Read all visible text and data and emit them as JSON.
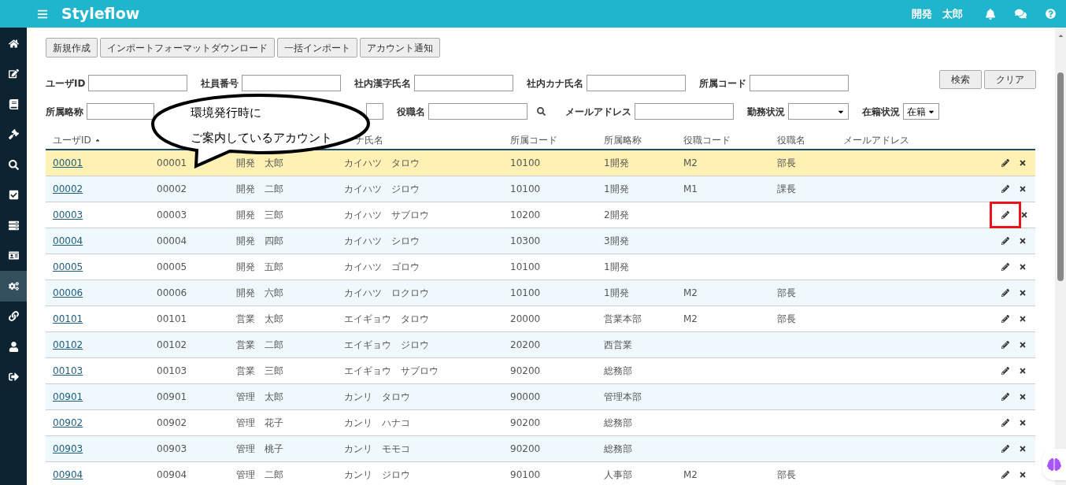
{
  "app": {
    "title": "Styleflow",
    "user_name": "開発　太郎"
  },
  "sidebar": {
    "items": [
      {
        "kind": "home",
        "selected": false
      },
      {
        "kind": "edit",
        "selected": false
      },
      {
        "kind": "book",
        "selected": false
      },
      {
        "kind": "gavel",
        "selected": false
      },
      {
        "kind": "search",
        "selected": false
      },
      {
        "kind": "check",
        "selected": false
      },
      {
        "kind": "list",
        "selected": false
      },
      {
        "kind": "card",
        "selected": false
      },
      {
        "kind": "cogs",
        "selected": true
      },
      {
        "kind": "link",
        "selected": false
      },
      {
        "kind": "user",
        "selected": false
      },
      {
        "kind": "logout",
        "selected": false
      }
    ]
  },
  "toolbar": {
    "buttons": [
      "新規作成",
      "インポートフォーマットダウンロード",
      "一括インポート",
      "アカウント通知"
    ]
  },
  "filters": {
    "row_1": [
      {
        "kind": "input",
        "label": "ユーザID"
      },
      {
        "kind": "input",
        "label": "社員番号"
      },
      {
        "kind": "input",
        "label": "社内漢字氏名"
      },
      {
        "kind": "input",
        "label": "社内カナ氏名"
      },
      {
        "kind": "input",
        "label": "所属コード"
      }
    ],
    "row_2": [
      {
        "kind": "input",
        "label": "所属略称"
      },
      {
        "kind": "input"
      },
      {
        "kind": "search_input",
        "label": "役職名"
      },
      {
        "kind": "input",
        "label": "メールアドレス"
      },
      {
        "kind": "select",
        "label": "勤務状況"
      },
      {
        "kind": "select",
        "label": "在籍状況",
        "value": "在籍"
      }
    ],
    "buttons": [
      "検索",
      "クリア"
    ]
  },
  "callout": {
    "lines": [
      "環境発行時に",
      "ご案内しているアカウント"
    ]
  },
  "table": {
    "columns": [
      {
        "label": "ユーザID",
        "sorted": true
      },
      {},
      {},
      {
        "label": "ナ氏名"
      },
      {
        "label": "所属コード"
      },
      {
        "label": "所属略称"
      },
      {
        "label": "役職コード"
      },
      {
        "label": "役職名"
      },
      {
        "label": "メールアドレス"
      }
    ],
    "rows": [
      {
        "user_id": "00001",
        "employee_no": "00001",
        "name": "開発　太郎",
        "kana": "カイハツ　タロウ",
        "dept_code": "10100",
        "dept_abbr": "1開発",
        "title_code": "M2",
        "title": "部長",
        "selected": true,
        "edit_marked": false
      },
      {
        "user_id": "00002",
        "employee_no": "00002",
        "name": "開発　二郎",
        "kana": "カイハツ　ジロウ",
        "dept_code": "10100",
        "dept_abbr": "1開発",
        "title_code": "M1",
        "title": "課長",
        "selected": false,
        "edit_marked": false
      },
      {
        "user_id": "00003",
        "employee_no": "00003",
        "name": "開発　三郎",
        "kana": "カイハツ　サブロウ",
        "dept_code": "10200",
        "dept_abbr": "2開発",
        "selected": false,
        "edit_marked": true
      },
      {
        "user_id": "00004",
        "employee_no": "00004",
        "name": "開発　四郎",
        "kana": "カイハツ　シロウ",
        "dept_code": "10300",
        "dept_abbr": "3開発",
        "selected": false,
        "edit_marked": false
      },
      {
        "user_id": "00005",
        "employee_no": "00005",
        "name": "開発　五郎",
        "kana": "カイハツ　ゴロウ",
        "dept_code": "10100",
        "dept_abbr": "1開発",
        "selected": false,
        "edit_marked": false
      },
      {
        "user_id": "00006",
        "employee_no": "00006",
        "name": "開発　六郎",
        "kana": "カイハツ　ロクロウ",
        "dept_code": "10100",
        "dept_abbr": "1開発",
        "title_code": "M2",
        "title": "部長",
        "selected": false,
        "edit_marked": false
      },
      {
        "user_id": "00101",
        "employee_no": "00101",
        "name": "営業　太郎",
        "kana": "エイギョウ　タロウ",
        "dept_code": "20000",
        "dept_abbr": "営業本部",
        "title_code": "M2",
        "title": "部長",
        "selected": false,
        "edit_marked": false
      },
      {
        "user_id": "00102",
        "employee_no": "00102",
        "name": "営業　二郎",
        "kana": "エイギョウ　ジロウ",
        "dept_code": "20200",
        "dept_abbr": "西営業",
        "selected": false,
        "edit_marked": false
      },
      {
        "user_id": "00103",
        "employee_no": "00103",
        "name": "営業　三郎",
        "kana": "エイギョウ　サブロウ",
        "dept_code": "90200",
        "dept_abbr": "総務部",
        "selected": false,
        "edit_marked": false
      },
      {
        "user_id": "00901",
        "employee_no": "00901",
        "name": "管理　太郎",
        "kana": "カンリ　タロウ",
        "dept_code": "90000",
        "dept_abbr": "管理本部",
        "selected": false,
        "edit_marked": false
      },
      {
        "user_id": "00902",
        "employee_no": "00902",
        "name": "管理　花子",
        "kana": "カンリ　ハナコ",
        "dept_code": "90200",
        "dept_abbr": "総務部",
        "selected": false,
        "edit_marked": false
      },
      {
        "user_id": "00903",
        "employee_no": "00903",
        "name": "管理　桃子",
        "kana": "カンリ　モモコ",
        "dept_code": "90200",
        "dept_abbr": "総務部",
        "selected": false,
        "edit_marked": false
      },
      {
        "user_id": "00904",
        "employee_no": "00904",
        "name": "管理　二郎",
        "kana": "カンリ　ジロウ",
        "dept_code": "90100",
        "dept_abbr": "人事部",
        "title_code": "M2",
        "title": "部長",
        "selected": false,
        "edit_marked": false
      }
    ]
  }
}
